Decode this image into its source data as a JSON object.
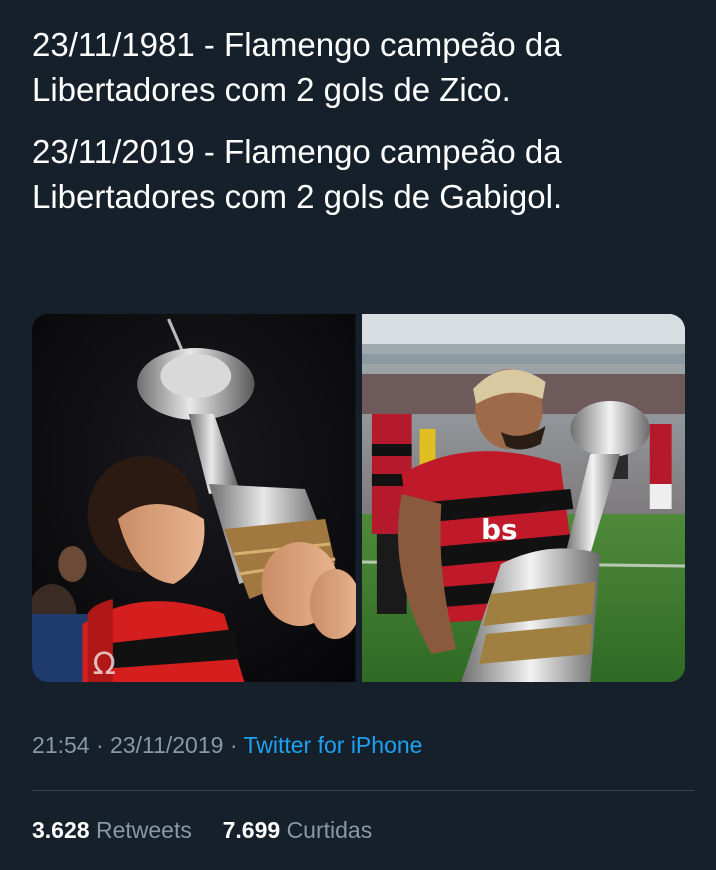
{
  "tweet": {
    "lines": [
      "23/11/1981 - Flamengo campeão da Libertadores com 2 gols de Zico.",
      "23/11/2019 - Flamengo campeão da Libertadores com 2 gols de Gabigol."
    ]
  },
  "media": {
    "photos": [
      {
        "icon": "photo-zico-kissing-trophy"
      },
      {
        "icon": "photo-gabigol-kissing-trophy"
      }
    ]
  },
  "meta": {
    "time": "21:54",
    "date": "23/11/2019",
    "separator": "·",
    "source": "Twitter for iPhone"
  },
  "stats": {
    "retweets_count": "3.628",
    "retweets_label": "Retweets",
    "likes_count": "7.699",
    "likes_label": "Curtidas"
  },
  "colors": {
    "background": "#15202b",
    "text": "#ffffff",
    "muted": "#8899a6",
    "link": "#1da1f2",
    "divider": "#38444d"
  }
}
